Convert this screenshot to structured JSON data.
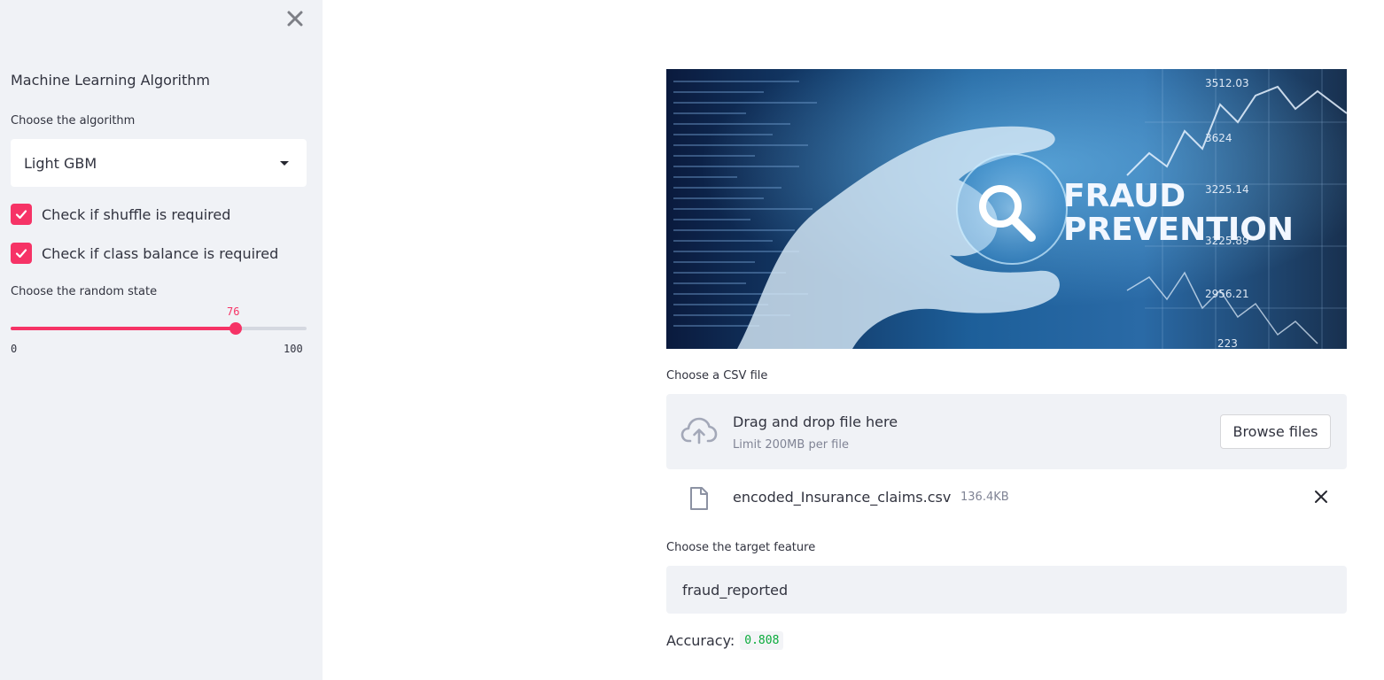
{
  "sidebar": {
    "title": "Machine Learning Algorithm",
    "close_icon": "close-icon",
    "algorithm": {
      "label": "Choose the algorithm",
      "selected": "Light GBM"
    },
    "shuffle": {
      "label": "Check if shuffle is required",
      "checked": true
    },
    "class_balance": {
      "label": "Check if class balance is required",
      "checked": true
    },
    "random_state": {
      "label": "Choose the random state",
      "value": "76",
      "min": "0",
      "max": "100"
    }
  },
  "main": {
    "banner": {
      "line1": "FRAUD",
      "line2": "PREVENTION",
      "ticks": [
        "3512.03",
        "3624",
        "3225.14",
        "3225.89",
        "2956.21",
        "223"
      ]
    },
    "uploader": {
      "label": "Choose a CSV file",
      "drop_text": "Drag and drop file here",
      "limit_text": "Limit 200MB per file",
      "browse_label": "Browse files"
    },
    "file": {
      "name": "encoded_Insurance_claims.csv",
      "size": "136.4KB"
    },
    "target": {
      "label": "Choose the target feature",
      "value": "fraud_reported"
    },
    "accuracy": {
      "label": "Accuracy:",
      "value": "0.808"
    }
  },
  "colors": {
    "accent": "#f63366",
    "sidebar_bg": "#f0f2f6",
    "success": "#09ab3b"
  }
}
